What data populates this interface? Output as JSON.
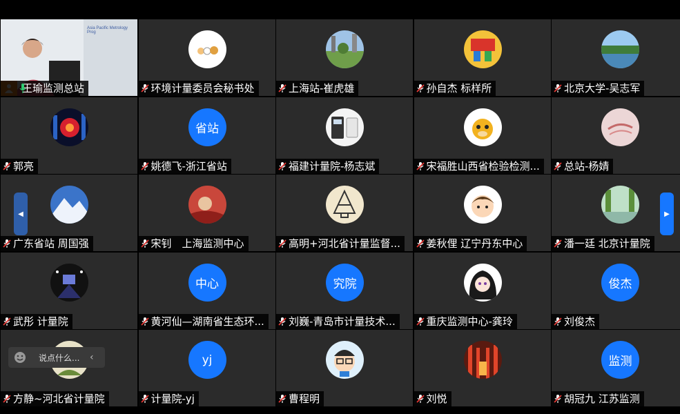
{
  "tiles": [
    {
      "name": "王瑜监测总站",
      "type": "video"
    },
    {
      "name": "环境计量委员会秘书处",
      "type": "image",
      "icon": "cartoon-figures-avatar"
    },
    {
      "name": "上海站-崔虎雄",
      "type": "image",
      "icon": "park-trees-avatar"
    },
    {
      "name": "孙自杰 标样所",
      "type": "image",
      "icon": "colorful-festival-avatar"
    },
    {
      "name": "北京大学-吴志军",
      "type": "image",
      "icon": "lake-landscape-avatar"
    },
    {
      "name": "郭亮",
      "type": "image",
      "icon": "night-lights-avatar"
    },
    {
      "name": "姚德飞-浙江省站",
      "type": "text",
      "text": "省站"
    },
    {
      "name": "福建计量院-杨志斌",
      "type": "image",
      "icon": "devices-avatar"
    },
    {
      "name": "宋福胜山西省检验检测...",
      "type": "image",
      "icon": "cartoon-cow-avatar"
    },
    {
      "name": "总站-杨婧",
      "type": "image",
      "icon": "pink-texture-avatar"
    },
    {
      "name": "广东省站 周国强",
      "type": "image",
      "icon": "snow-mountain-avatar"
    },
    {
      "name": "宋钊　上海监测中心",
      "type": "image",
      "icon": "red-fabric-avatar"
    },
    {
      "name": "高明+河北省计量监督...",
      "type": "image",
      "icon": "tower-sketch-avatar"
    },
    {
      "name": "姜秋俚 辽宁丹东中心",
      "type": "image",
      "icon": "cartoon-boy-avatar"
    },
    {
      "name": "潘一廷 北京计量院",
      "type": "image",
      "icon": "green-lake-avatar"
    },
    {
      "name": "武彤 计量院",
      "type": "image",
      "icon": "stage-lights-avatar"
    },
    {
      "name": "黄河仙—湖南省生态环...",
      "type": "text",
      "text": "中心"
    },
    {
      "name": "刘巍-青岛市计量技术...",
      "type": "text",
      "text": "究院"
    },
    {
      "name": "重庆监测中心-龚玲",
      "type": "image",
      "icon": "anime-girl-avatar"
    },
    {
      "name": "刘俊杰",
      "type": "text",
      "text": "俊杰"
    },
    {
      "name": "方静~河北省计量院",
      "type": "image",
      "icon": "flower-avatar"
    },
    {
      "name": "计量院-yj",
      "type": "text",
      "text": "yj"
    },
    {
      "name": "曹程明",
      "type": "image",
      "icon": "cartoon-glasses-avatar"
    },
    {
      "name": "刘悦",
      "type": "image",
      "icon": "torii-gates-avatar"
    },
    {
      "name": "胡冠九 江苏监测",
      "type": "text",
      "text": "监测"
    }
  ],
  "video_banner": "Asia Pacific Metrology Prog",
  "chat": {
    "placeholder": "说点什么..."
  },
  "nav": {
    "prev": "◀",
    "next": "▶"
  },
  "colors": {
    "accent": "#1677ff",
    "host": "#f5891f",
    "mic_on": "#2ecc71",
    "muted": "#e53935"
  }
}
